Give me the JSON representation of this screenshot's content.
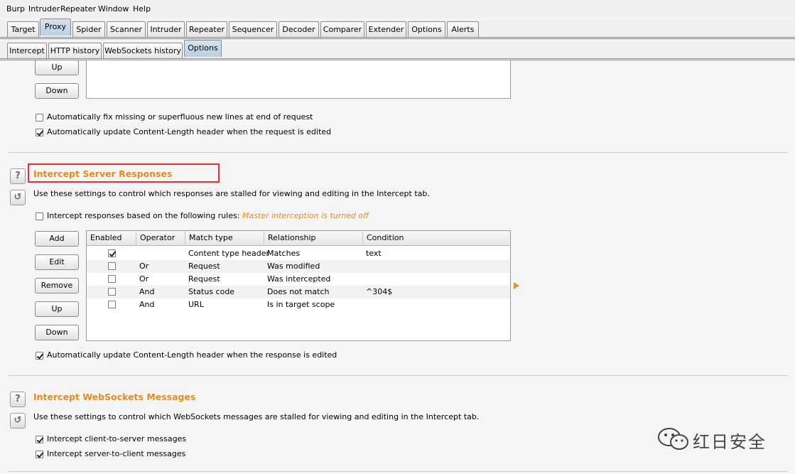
{
  "menubar": {
    "items": [
      "Burp",
      "Intruder",
      "Repeater",
      "Window",
      "Help"
    ]
  },
  "main_tabs": [
    "Target",
    "Proxy",
    "Spider",
    "Scanner",
    "Intruder",
    "Repeater",
    "Sequencer",
    "Decoder",
    "Comparer",
    "Extender",
    "Options",
    "Alerts"
  ],
  "main_selected": "Proxy",
  "sub_tabs": [
    "Intercept",
    "HTTP history",
    "WebSockets history",
    "Options"
  ],
  "sub_selected": "Options",
  "request_section": {
    "buttons": {
      "up": "Up",
      "down": "Down"
    },
    "fix_newlines": {
      "label": "Automatically fix missing or superfluous new lines at end of request",
      "checked": false
    },
    "update_length": {
      "label": "Automatically update Content-Length header when the request is edited",
      "checked": true
    }
  },
  "response_section": {
    "title": "Intercept Server Responses",
    "description": "Use these settings to control which responses are stalled for viewing and editing in the Intercept tab.",
    "intercept_rule_label": "Intercept responses based on the following rules:",
    "intercept_rule_note": "Master interception is turned off",
    "intercept_rule_checked": false,
    "buttons": {
      "add": "Add",
      "edit": "Edit",
      "remove": "Remove",
      "up": "Up",
      "down": "Down"
    },
    "table": {
      "columns": [
        "Enabled",
        "Operator",
        "Match type",
        "Relationship",
        "Condition"
      ],
      "rows": [
        {
          "enabled": true,
          "operator": "",
          "match_type": "Content type header",
          "relationship": "Matches",
          "condition": "text"
        },
        {
          "enabled": false,
          "operator": "Or",
          "match_type": "Request",
          "relationship": "Was modified",
          "condition": ""
        },
        {
          "enabled": false,
          "operator": "Or",
          "match_type": "Request",
          "relationship": "Was intercepted",
          "condition": ""
        },
        {
          "enabled": false,
          "operator": "And",
          "match_type": "Status code",
          "relationship": "Does not match",
          "condition": "^304$"
        },
        {
          "enabled": false,
          "operator": "And",
          "match_type": "URL",
          "relationship": "Is in target scope",
          "condition": ""
        }
      ]
    },
    "update_length": {
      "label": "Automatically update Content-Length header when the response is edited",
      "checked": true
    }
  },
  "websockets_section": {
    "title": "Intercept WebSockets Messages",
    "description": "Use these settings to control which WebSockets messages are stalled for viewing and editing in the Intercept tab.",
    "client_to_server": {
      "label": "Intercept client-to-server messages",
      "checked": true
    },
    "server_to_client": {
      "label": "Intercept server-to-client messages",
      "checked": true
    }
  },
  "icons": {
    "help": "?",
    "reset": "↺"
  },
  "watermark": "红日安全",
  "colors": {
    "section_title": "#e58a1f",
    "highlight_box": "#e03030",
    "selected_tab": "#c4d6e8"
  }
}
